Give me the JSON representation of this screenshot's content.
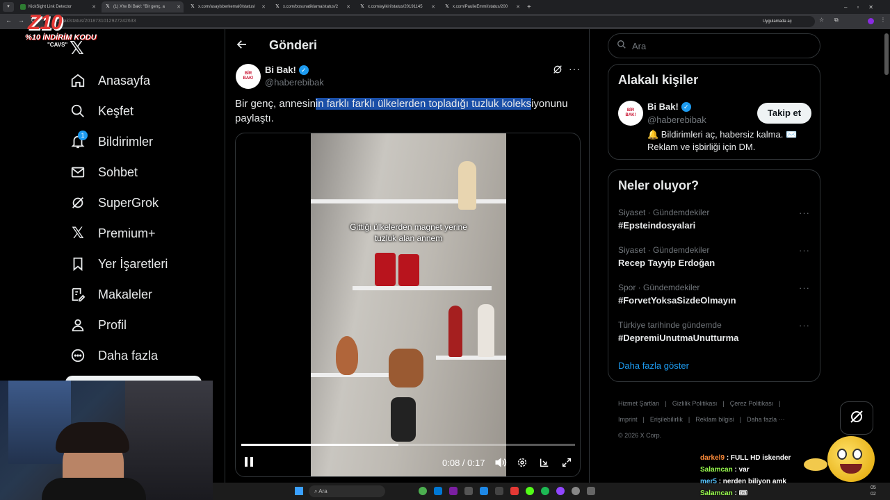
{
  "browser": {
    "tabs": [
      {
        "title": "KickSight Link Detector"
      },
      {
        "title": "(1) X'te Bi Bak!: \"Bir genç, a"
      },
      {
        "title": "x.com/asayisberkemal0/status/"
      },
      {
        "title": "x.com/bosunatiklama/status/2"
      },
      {
        "title": "x.com/ayikiri/status/20191145"
      },
      {
        "title": "x.com/PaulieEmmi/status/200"
      }
    ],
    "url": "rebibak/status/2018731012927242633",
    "open_in_app": "Uygulamada aç"
  },
  "overlay": {
    "logo_text": "Z10",
    "promo_line1": "%10 İNDİRİM KODU",
    "promo_line2": "\"CAVS\""
  },
  "nav": {
    "items": [
      {
        "label": "Anasayfa",
        "icon": "home-icon"
      },
      {
        "label": "Keşfet",
        "icon": "search-icon"
      },
      {
        "label": "Bildirimler",
        "icon": "bell-icon",
        "badge": "1"
      },
      {
        "label": "Sohbet",
        "icon": "mail-icon"
      },
      {
        "label": "SuperGrok",
        "icon": "grok-icon"
      },
      {
        "label": "Premium+",
        "icon": "x-logo-icon"
      },
      {
        "label": "Yer İşaretleri",
        "icon": "bookmark-icon"
      },
      {
        "label": "Makaleler",
        "icon": "article-icon"
      },
      {
        "label": "Profil",
        "icon": "person-icon"
      },
      {
        "label": "Daha fazla",
        "icon": "more-circle-icon"
      }
    ]
  },
  "post": {
    "header_title": "Gönderi",
    "author_name": "Bi Bak!",
    "author_handle": "@haberebibak",
    "avatar_text": "BİR BAK!",
    "text_before": "Bir genç, annesin",
    "text_highlight": "in farklı farklı ülkelerden topladığı tuzluk koleks",
    "text_after": "iyonunu",
    "text_line2": "paylaştı.",
    "video": {
      "caption_line1": "Gittiği ülkelerden magnet yerine",
      "caption_line2": "tuzluk alan annem",
      "time": "0:08 / 0:17",
      "progress": 0.47
    }
  },
  "search": {
    "placeholder": "Ara"
  },
  "related": {
    "title": "Alakalı kişiler",
    "name": "Bi Bak!",
    "handle": "@haberebibak",
    "bio_line1": "🔔 Bildirimleri aç, habersiz kalma. ✉️",
    "bio_line2": "Reklam ve işbirliği için DM.",
    "follow_label": "Takip et"
  },
  "trends": {
    "title": "Neler oluyor?",
    "items": [
      {
        "category": "Siyaset · Gündemdekiler",
        "name": "#Epsteindosyalari"
      },
      {
        "category": "Siyaset · Gündemdekiler",
        "name": "Recep Tayyip Erdoğan"
      },
      {
        "category": "Spor · Gündemdekiler",
        "name": "#ForvetYoksaSizdeOlmayın"
      },
      {
        "category": "Türkiye tarihinde gündemde",
        "name": "#DepremiUnutmaUnutturma"
      }
    ],
    "show_more": "Daha fazla göster"
  },
  "footer": {
    "links": [
      "Hizmet Şartları",
      "Gizlilik Politikası",
      "Çerez Politikası",
      "Imprint",
      "Erişilebilirlik",
      "Reklam bilgisi",
      "Daha fazla ···"
    ],
    "copyright": "© 2026 X Corp."
  },
  "chat": [
    {
      "user": "darkel9",
      "msg": ": FULL HD iskender",
      "color": "#ff8c3a"
    },
    {
      "user": "Salamcan",
      "msg": ": var",
      "color": "#9bff4f"
    },
    {
      "user": "mer5",
      "msg": ": nerden biliyon amk",
      "color": "#58c4ff"
    },
    {
      "user": "Salamcan",
      "msg": ": 🎟",
      "color": "#9bff4f"
    }
  ],
  "taskbar": {
    "search_placeholder": "Ara",
    "clock_time": "05",
    "clock_date": "02"
  },
  "colors": {
    "accent": "#1d9bf0",
    "highlight": "#1a4fa8",
    "bg": "#000000"
  }
}
